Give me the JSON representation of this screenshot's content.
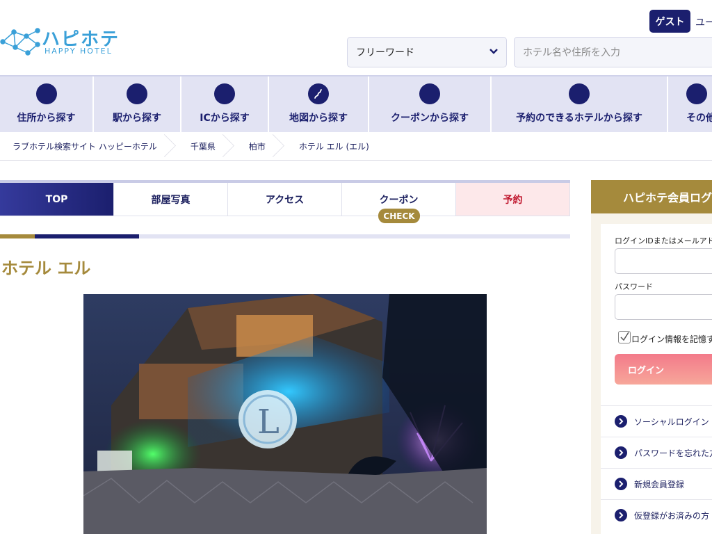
{
  "header": {
    "logo_text": "ハピホテ",
    "logo_sub": "HAPPY HOTEL",
    "guest_label": "ゲスト",
    "user_label": "ユー",
    "search_select": "フリーワード",
    "search_placeholder": "ホテル名や住所を入力"
  },
  "nav": {
    "items": [
      {
        "label": "住所から探す",
        "icon": "map-pin-icon"
      },
      {
        "label": "駅から探す",
        "icon": "train-icon"
      },
      {
        "label": "ICから探す",
        "icon": "car-icon"
      },
      {
        "label": "地図から探す",
        "icon": "japan-map-icon"
      },
      {
        "label": "クーポンから探す",
        "icon": "coupon-icon"
      },
      {
        "label": "予約のできるホテルから探す",
        "icon": "calendar-icon"
      },
      {
        "label": "その他",
        "icon": "more-icon"
      }
    ]
  },
  "breadcrumb": [
    "ラブホテル検索サイト ハッピーホテル",
    "千葉県",
    "柏市",
    "ホテル エル (エル)"
  ],
  "tabs": {
    "items": [
      "TOP",
      "部屋写真",
      "アクセス",
      "クーポン",
      "予約"
    ],
    "check_badge": "CHECK"
  },
  "hotel": {
    "name": "ホテル エル"
  },
  "login": {
    "title": "ハピホテ会員ログ",
    "id_label": "ログインIDまたはメールアドレ",
    "password_label": "パスワード",
    "remember_label": "ログイン情報を記憶す",
    "login_button": "ログイン",
    "links": [
      "ソーシャルログイン",
      "パスワードを忘れた方",
      "新規会員登録",
      "仮登録がお済みの方"
    ]
  },
  "colors": {
    "navy": "#1b1f6e",
    "gold": "#a58a3c",
    "nav_bg": "#e2e3f3",
    "reserve_red": "#c0182f",
    "login_pink": "#f37a8a"
  }
}
